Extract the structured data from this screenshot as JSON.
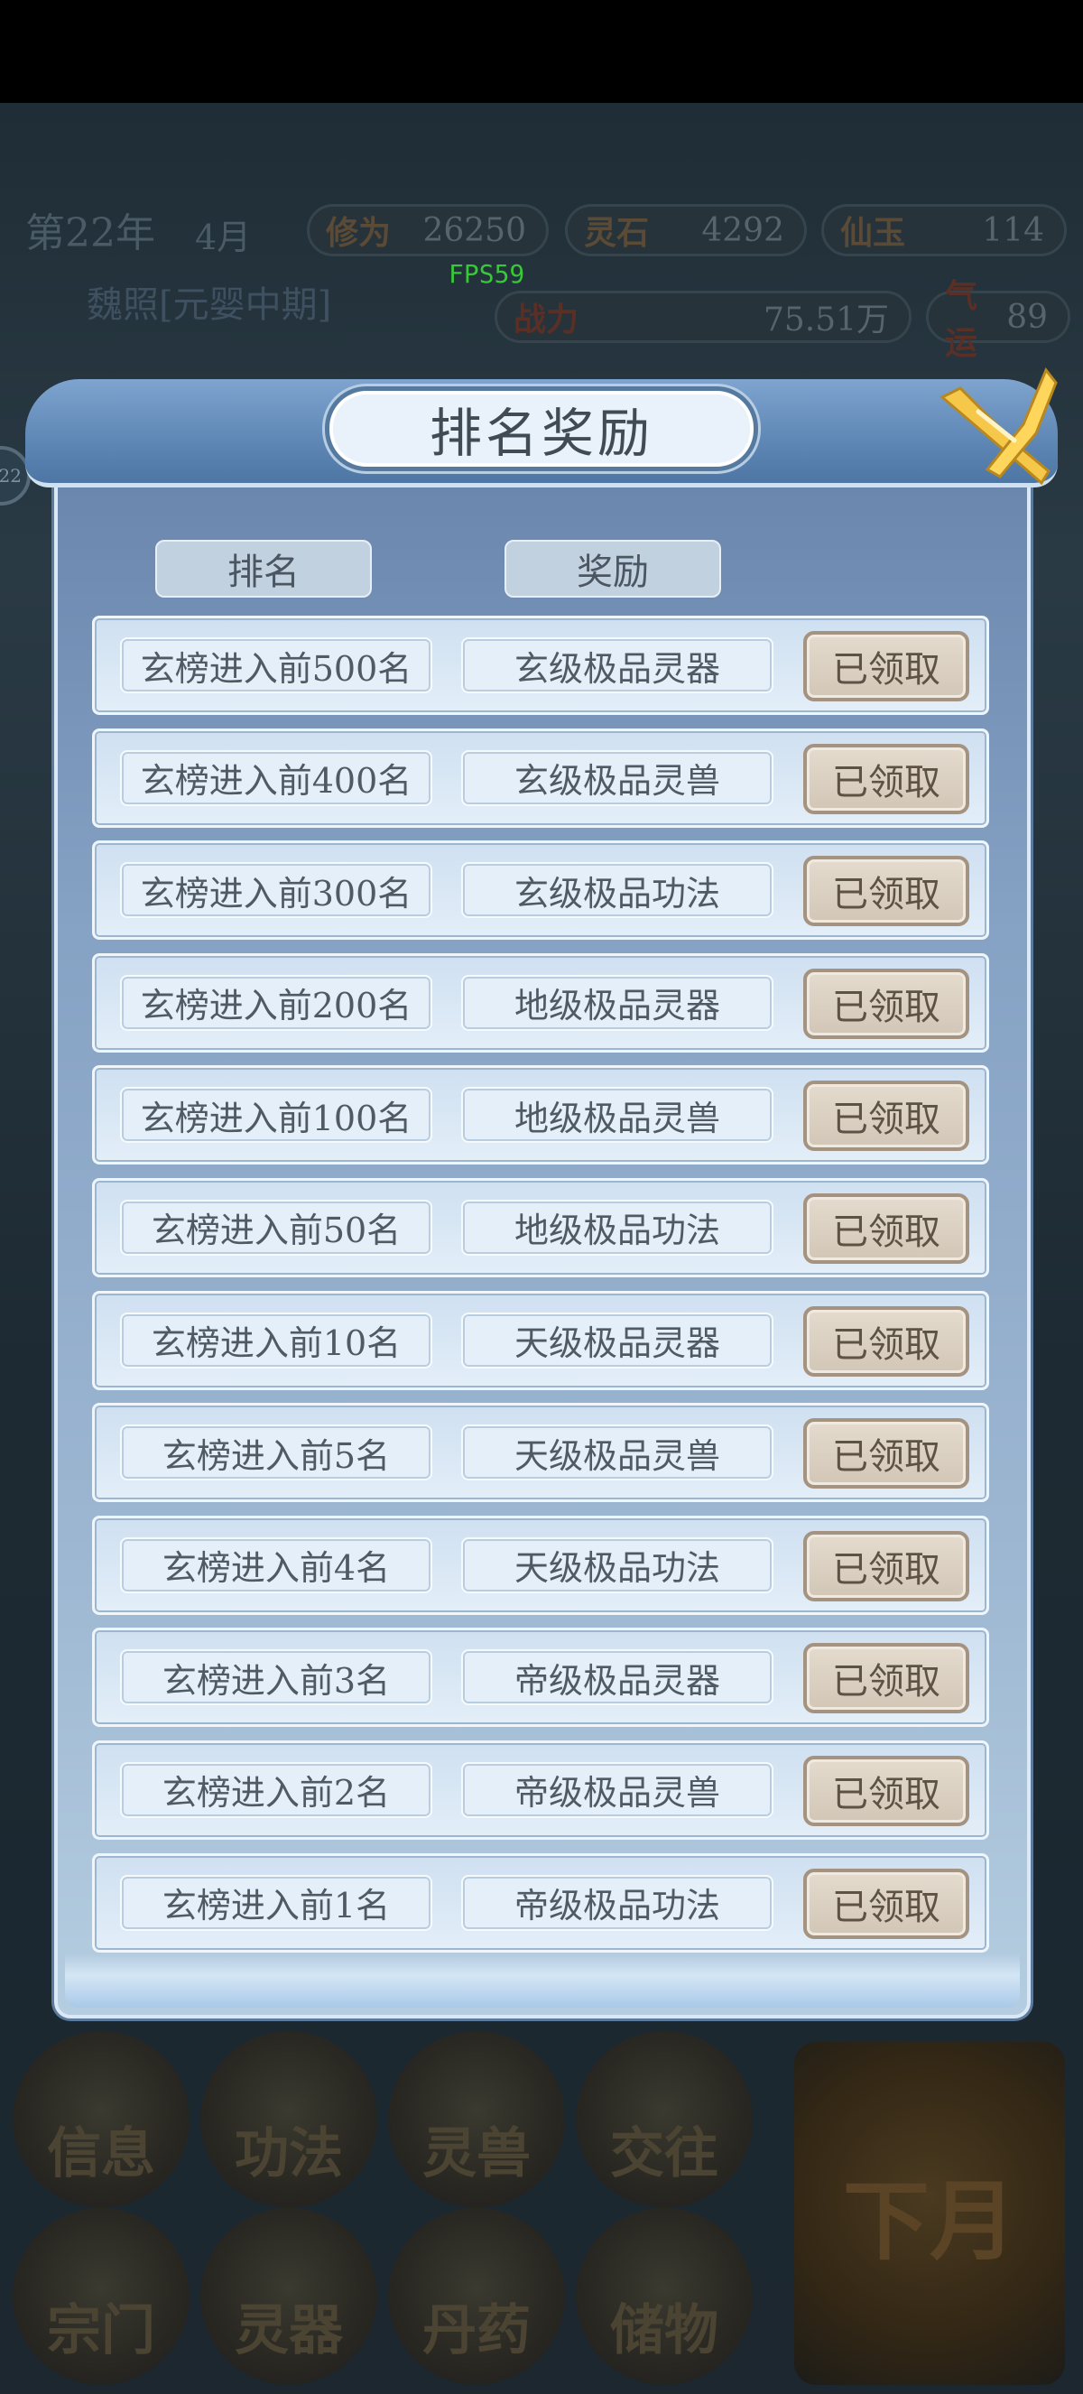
{
  "hud": {
    "year": "第22年",
    "month": "4月",
    "player": "魏照[元婴中期]",
    "fps": "FPS59",
    "side_badge": "22",
    "stats": {
      "xiuwei_label": "修为",
      "xiuwei_value": "26250",
      "lingshi_label": "灵石",
      "lingshi_value": "4292",
      "xianyu_label": "仙玉",
      "xianyu_value": "114",
      "zhanli_label": "战力",
      "zhanli_value": "75.51万",
      "qiyun_label": "气运",
      "qiyun_value": "89"
    }
  },
  "bottom_nav": {
    "info": "信息",
    "skills": "功法",
    "beasts": "灵兽",
    "social": "交往",
    "sect": "宗门",
    "artifacts": "灵器",
    "pills": "丹药",
    "storage": "储物",
    "next_month": "下月"
  },
  "dialog": {
    "title": "排名奖励",
    "col_rank": "排名",
    "col_reward": "奖励",
    "rows": [
      {
        "rank": "玄榜进入前500名",
        "reward": "玄级极品灵器",
        "status": "已领取"
      },
      {
        "rank": "玄榜进入前400名",
        "reward": "玄级极品灵兽",
        "status": "已领取"
      },
      {
        "rank": "玄榜进入前300名",
        "reward": "玄级极品功法",
        "status": "已领取"
      },
      {
        "rank": "玄榜进入前200名",
        "reward": "地级极品灵器",
        "status": "已领取"
      },
      {
        "rank": "玄榜进入前100名",
        "reward": "地级极品灵兽",
        "status": "已领取"
      },
      {
        "rank": "玄榜进入前50名",
        "reward": "地级极品功法",
        "status": "已领取"
      },
      {
        "rank": "玄榜进入前10名",
        "reward": "天级极品灵器",
        "status": "已领取"
      },
      {
        "rank": "玄榜进入前5名",
        "reward": "天级极品灵兽",
        "status": "已领取"
      },
      {
        "rank": "玄榜进入前4名",
        "reward": "天级极品功法",
        "status": "已领取"
      },
      {
        "rank": "玄榜进入前3名",
        "reward": "帝级极品灵器",
        "status": "已领取"
      },
      {
        "rank": "玄榜进入前2名",
        "reward": "帝级极品灵兽",
        "status": "已领取"
      },
      {
        "rank": "玄榜进入前1名",
        "reward": "帝级极品功法",
        "status": "已领取"
      }
    ]
  }
}
